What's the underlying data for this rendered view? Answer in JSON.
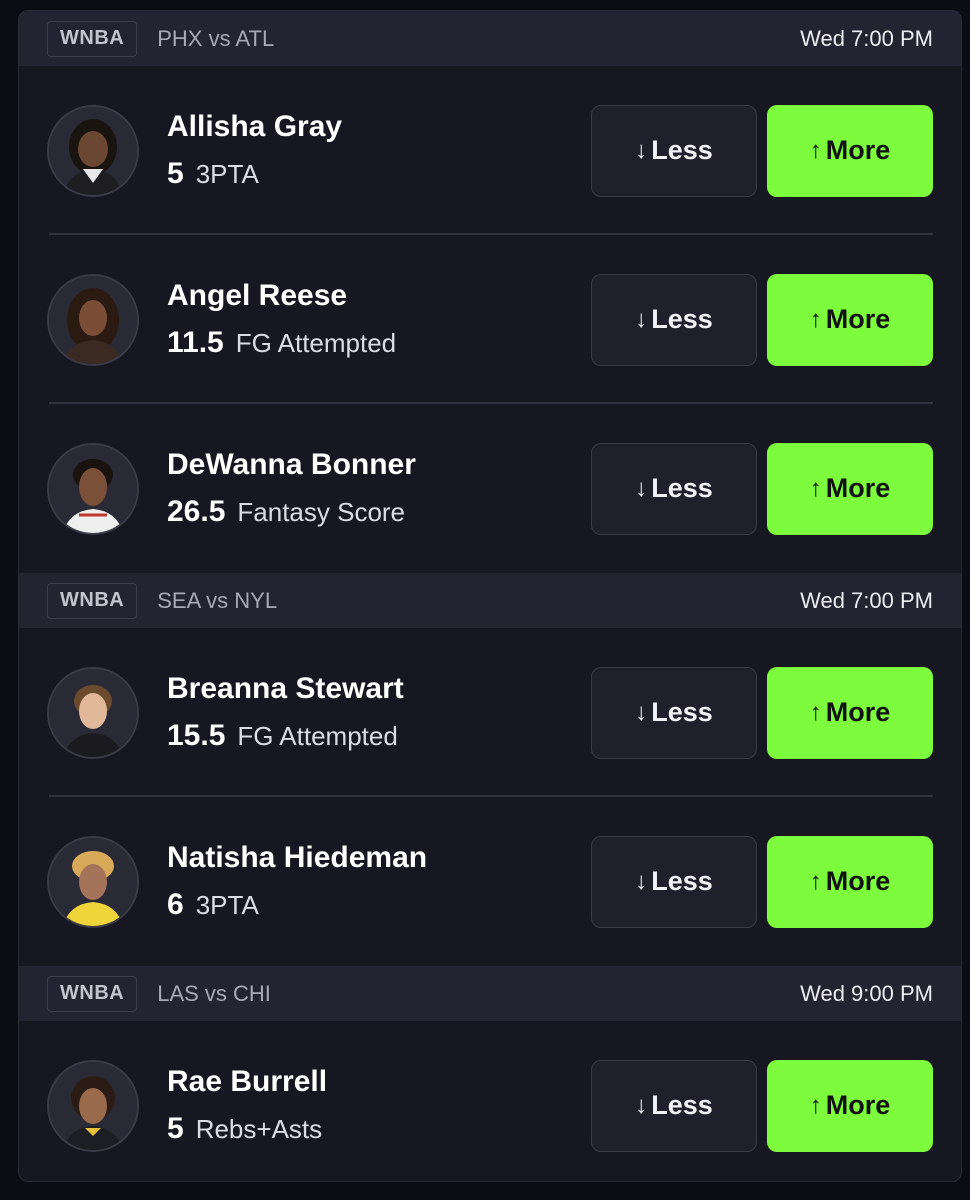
{
  "games": [
    {
      "league": "WNBA",
      "matchup": "PHX vs ATL",
      "time": "Wed 7:00 PM",
      "players": [
        {
          "name": "Allisha Gray",
          "line": "5",
          "stat": "3PTA"
        },
        {
          "name": "Angel Reese",
          "line": "11.5",
          "stat": "FG Attempted"
        },
        {
          "name": "DeWanna Bonner",
          "line": "26.5",
          "stat": "Fantasy Score"
        }
      ]
    },
    {
      "league": "WNBA",
      "matchup": "SEA vs NYL",
      "time": "Wed 7:00 PM",
      "players": [
        {
          "name": "Breanna Stewart",
          "line": "15.5",
          "stat": "FG Attempted"
        },
        {
          "name": "Natisha Hiedeman",
          "line": "6",
          "stat": "3PTA"
        }
      ]
    },
    {
      "league": "WNBA",
      "matchup": "LAS vs CHI",
      "time": "Wed 9:00 PM",
      "players": [
        {
          "name": "Rae Burrell",
          "line": "5",
          "stat": "Rebs+Asts"
        }
      ]
    }
  ],
  "buttons": {
    "less_arrow": "↓",
    "less_label": "Less",
    "more_arrow": "↑",
    "more_label": "More"
  },
  "colors": {
    "more_button": "#7cfc3c",
    "background": "#171722",
    "header": "#232331"
  },
  "icons": {
    "avatar": "player-photo-avatar",
    "less": "arrow-down-icon",
    "more": "arrow-up-icon"
  }
}
